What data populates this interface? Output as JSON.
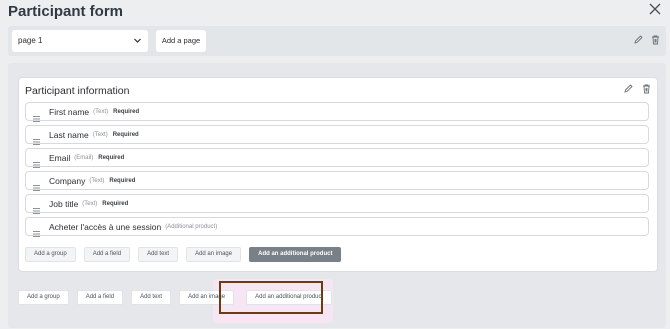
{
  "header": {
    "title": "Participant form",
    "close_icon": "close-icon"
  },
  "page_bar": {
    "selected_page": "page 1",
    "add_page_label": "Add a page"
  },
  "group": {
    "title": "Participant information",
    "fields": [
      {
        "label": "First name",
        "type": "(Text)",
        "required": "Required"
      },
      {
        "label": "Last name",
        "type": "(Text)",
        "required": "Required"
      },
      {
        "label": "Email",
        "type": "(Email)",
        "required": "Required"
      },
      {
        "label": "Company",
        "type": "(Text)",
        "required": "Required"
      },
      {
        "label": "Job title",
        "type": "(Text)",
        "required": "Required"
      },
      {
        "label": "Acheter l'accès à une session",
        "type": "(Additional product)",
        "required": ""
      }
    ],
    "buttons": [
      "Add a group",
      "Add a field",
      "Add text",
      "Add an image",
      "Add an additional product"
    ]
  },
  "bottom_buttons": [
    "Add a group",
    "Add a field",
    "Add text",
    "Add an image",
    "Add an additional product"
  ],
  "colors": {
    "highlight_border": "#6b3b12",
    "highlight_bg": "#f6e6f3",
    "dark_button": "#7a8088"
  }
}
